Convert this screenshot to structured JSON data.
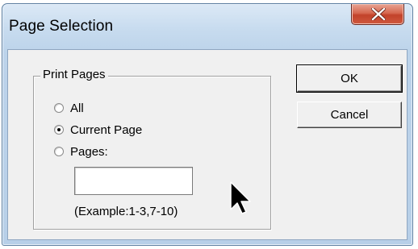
{
  "window": {
    "title": "Page Selection",
    "close_icon": "close-x-icon"
  },
  "group": {
    "label": "Print Pages",
    "options": [
      {
        "label": "All",
        "checked": false
      },
      {
        "label": "Current Page",
        "checked": true
      },
      {
        "label": "Pages:",
        "checked": false
      }
    ],
    "pages_input": {
      "value": "",
      "placeholder": ""
    },
    "example": "(Example:1-3,7-10)"
  },
  "buttons": {
    "ok": "OK",
    "cancel": "Cancel"
  },
  "colors": {
    "titlebar": "#c8dcef",
    "close_button": "#c94a31",
    "client_bg": "#f0f0f0"
  }
}
